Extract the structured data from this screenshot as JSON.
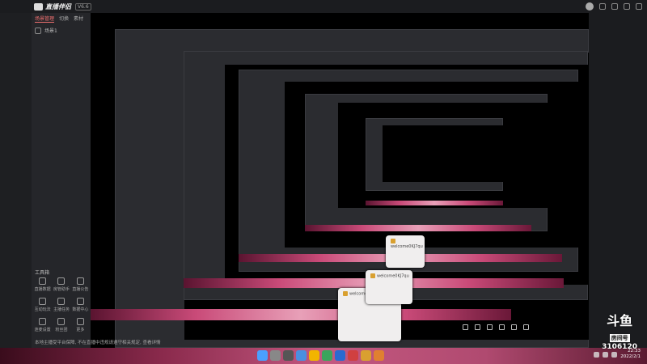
{
  "app": {
    "name": "直播伴侣",
    "version": "V6.6",
    "sidebar_tabs": [
      "场景管理",
      "切换",
      "素材"
    ],
    "scene_label": "场景1",
    "tools_title": "工具箱",
    "tools": [
      "直播数据",
      "房管助手",
      "直播公告",
      "互动玩法",
      "主播任务",
      "数据中心",
      "连麦设置",
      "粉丝团",
      "更多"
    ],
    "notice": "本地主播受平台保障, 不在直播中违规请遵守相关规定, 查看详情",
    "header_text": "在此输入直播标题",
    "status": "直播中"
  },
  "cards": [
    {
      "user": "welcome0KJ7qu"
    },
    {
      "user": "welcome0KJ7qu"
    },
    {
      "user": "welcome0KJ7qu"
    }
  ],
  "watermark": {
    "logo": "斗鱼",
    "label": "房间号",
    "number": "3106120"
  },
  "taskbar": {
    "time": "22:33",
    "date": "2022/2/1"
  },
  "colors": {
    "accent": "#f07070",
    "brand": "#d9a030",
    "taskbar_pink": "#c45880"
  }
}
